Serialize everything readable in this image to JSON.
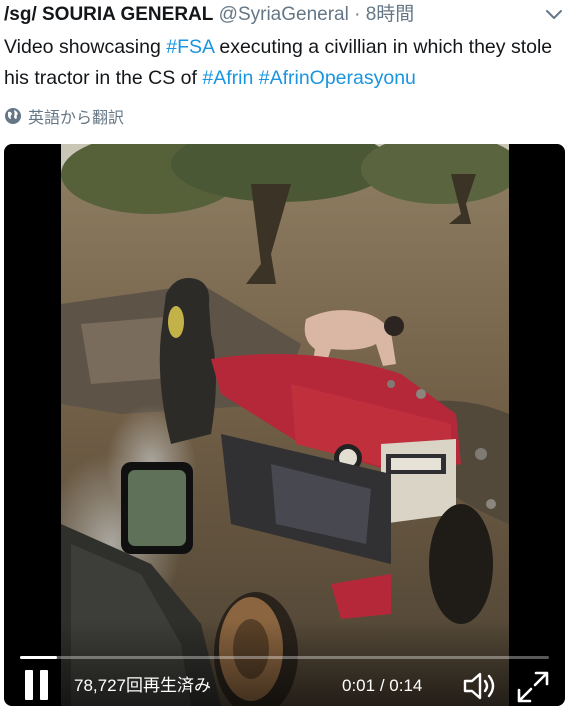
{
  "tweet": {
    "display_name": "/sg/ SOURIA GENERAL",
    "handle": "@SyriaGeneral",
    "separator": "·",
    "time": "8時間",
    "text_part1": "Video showcasing ",
    "hashtag_fsa": "#FSA",
    "text_part2": " executing a civillian in which they stole his tractor in the CS of ",
    "hashtag_afrin": "#Afrin",
    "text_space": " ",
    "hashtag_op": "#AfrinOperasyonu",
    "translate_label": "英語から翻訳",
    "menu_icon": "chevron-down-icon",
    "translate_icon": "globe-icon"
  },
  "video": {
    "views": "78,727回再生済み",
    "current_time": "0:01",
    "separator": " / ",
    "duration": "0:14",
    "progress_fraction": 0.07,
    "icons": [
      "pause-icon",
      "volume-icon",
      "fullscreen-icon"
    ]
  },
  "colors": {
    "link": "#1b95e0",
    "muted": "#657786",
    "tractor_red": "#c0303c"
  }
}
